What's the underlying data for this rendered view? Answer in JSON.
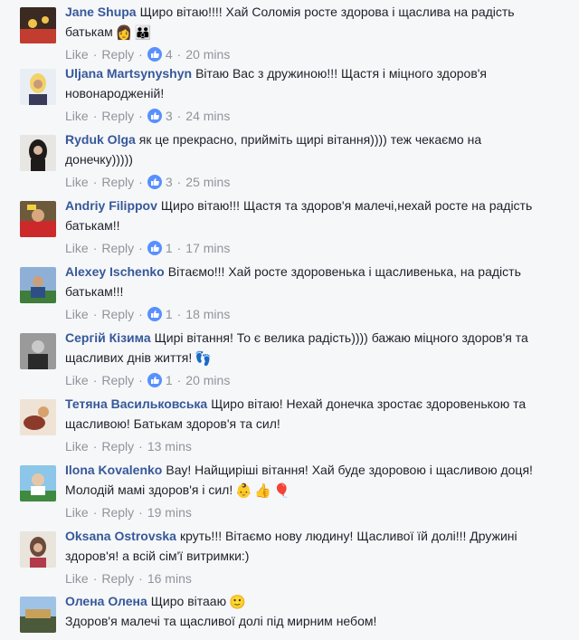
{
  "comments": [
    {
      "author": "Jane Shupa",
      "text": "Щиро вітаю!!!! Хай Соломія росте здорова і щаслива на радість батькам",
      "emoji": [
        "👩",
        "👪"
      ],
      "like_label": "Like",
      "reply_label": "Reply",
      "reactions": "4",
      "time": "20 mins",
      "avatar_colors": [
        "#3a2a22",
        "#c23c2f",
        "#f0c24b"
      ]
    },
    {
      "author": "Uljana Martsynyshyn",
      "text": "Вітаю Вас з дружиною!!! Щастя і міцного здоров'я новонародженій!",
      "emoji": [],
      "like_label": "Like",
      "reply_label": "Reply",
      "reactions": "3",
      "time": "24 mins",
      "avatar_colors": [
        "#e9eef5",
        "#f1d36a",
        "#c99a7a"
      ]
    },
    {
      "author": "Ryduk Olga",
      "text": "як це прекрасно, прийміть щирі вітання)))) теж чекаємо на донечку)))))",
      "emoji": [],
      "like_label": "Like",
      "reply_label": "Reply",
      "reactions": "3",
      "time": "25 mins",
      "avatar_colors": [
        "#e8e6e3",
        "#1e1b1a",
        "#d8b7a1"
      ]
    },
    {
      "author": "Andriy Filippov",
      "text": "Щиро вітаю!!! Щастя та здоров'я малечі,нехай росте на радість батькам!!",
      "emoji": [],
      "like_label": "Like",
      "reply_label": "Reply",
      "reactions": "1",
      "time": "17 mins",
      "avatar_colors": [
        "#6d5a3d",
        "#cc2a2a",
        "#f0d040"
      ]
    },
    {
      "author": "Alexey Ischenko",
      "text": "Вітаємо!!! Хай росте здоровенька і щасливенька, на радість батькам!!!",
      "emoji": [],
      "like_label": "Like",
      "reply_label": "Reply",
      "reactions": "1",
      "time": "18 mins",
      "avatar_colors": [
        "#8fb0d6",
        "#2e4f86",
        "#3f7d3a"
      ]
    },
    {
      "author": "Сергій Кізима",
      "text": "Щирі вітання! То є велика радість)))) бажаю міцного здоров'я та щасливих днів життя!",
      "emoji": [
        "👣"
      ],
      "like_label": "Like",
      "reply_label": "Reply",
      "reactions": "1",
      "time": "20 mins",
      "avatar_colors": [
        "#9a9a9a",
        "#2a2a2a",
        "#c9c9c9"
      ]
    },
    {
      "author": "Тетяна Васильковська",
      "text": "Щиро вітаю! Нехай донечка зростає здоровенькою та щасливою! Батькам здоров'я та сил!",
      "emoji": [],
      "like_label": "Like",
      "reply_label": "Reply",
      "reactions": "",
      "time": "13 mins",
      "avatar_colors": [
        "#efe3d6",
        "#8c3b2b",
        "#d7a26c"
      ]
    },
    {
      "author": "Ilona Kovalenko",
      "text": "Вау! Найщиріші вітання! Хай буде здоровою і щасливою доця! Молодій мамі здоров'я і сил!",
      "emoji": [
        "👶",
        "👍",
        "🎈"
      ],
      "like_label": "Like",
      "reply_label": "Reply",
      "reactions": "",
      "time": "19 mins",
      "avatar_colors": [
        "#8cc6e8",
        "#3f8a3f",
        "#e6c6a8"
      ]
    },
    {
      "author": "Oksana Ostrovska",
      "text": "круть!!! Вітаємо нову людину! Щасливої їй долі!!! Дружині здоров'я! а всій сім'ї витримки:)",
      "emoji": [],
      "like_label": "Like",
      "reply_label": "Reply",
      "reactions": "",
      "time": "16 mins",
      "avatar_colors": [
        "#e9e4dc",
        "#6a4a3a",
        "#e0b49a"
      ]
    },
    {
      "author": "Олена Олена",
      "text": "Щиро вітааю",
      "text2": "Здоров'я малечі та щасливої долі під мирним небом!",
      "emoji": [
        "🙂"
      ],
      "like_label": "",
      "reply_label": "",
      "reactions": "",
      "time": "",
      "avatar_colors": [
        "#9fc3e6",
        "#c7a15a",
        "#4a5a3a"
      ]
    }
  ]
}
